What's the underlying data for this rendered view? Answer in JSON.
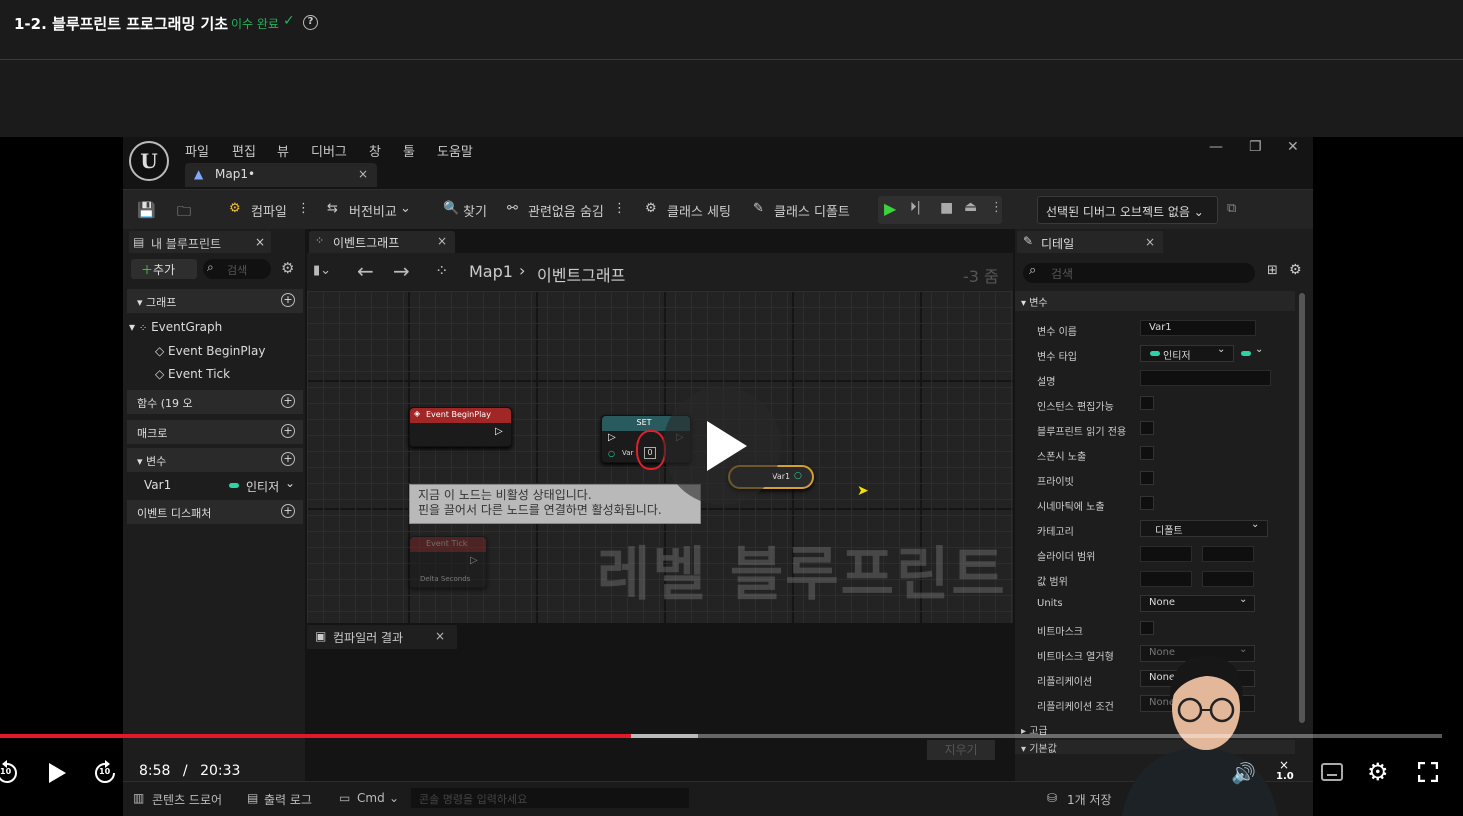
{
  "header": {
    "title": "1-2. 블루프린트 프로그래밍 기초",
    "status": "이수 완료",
    "help": "?"
  },
  "ue": {
    "menu": [
      "파일",
      "편집",
      "뷰",
      "디버그",
      "창",
      "툴",
      "도움말"
    ],
    "logo": "U",
    "map_tab": "Map1•",
    "toolbar": {
      "compile": "컴파일",
      "diff": "버전비교",
      "find": "찾기",
      "hide_unrelated": "관련없음 숨김",
      "class_settings": "클래스 세팅",
      "class_defaults": "클래스 디폴트",
      "debug_object": "선택된 디버그 오브젝트 없음"
    },
    "my_blueprint": {
      "tab": "내 블루프린트",
      "add": "추가",
      "search_placeholder": "검색",
      "graphs": "그래프",
      "event_graph": "EventGraph",
      "begin_play": "Event BeginPlay",
      "tick": "Event Tick",
      "functions": "함수 (19 오",
      "macros": "매크로",
      "variables": "변수",
      "var_name": "Var1",
      "var_type": "인티저",
      "dispatchers": "이벤트 디스패처"
    },
    "graph": {
      "tab": "이벤트그래프",
      "breadcrumb_root": "Map1",
      "breadcrumb_current": "이벤트그래프",
      "zoom": "-3 줌",
      "node_begin": "Event BeginPlay",
      "node_set": "SET",
      "node_set_var": "Var",
      "node_set_value": "0",
      "node_get": "Var1",
      "node_tick": "Event Tick",
      "node_tick_pin": "Delta Seconds",
      "tooltip_line1": "지금 이 노드는 비활성 상태입니다.",
      "tooltip_line2": "핀을 끌어서 다른 노드를 연결하면 활성화됩니다.",
      "watermark": "레벨 블루프린트"
    },
    "compiler": {
      "tab": "컴파일러 결과",
      "clear": "지우기"
    },
    "details": {
      "tab": "디테일",
      "search_placeholder": "검색",
      "section_variable": "변수",
      "labels": [
        "변수 이름",
        "변수 타입",
        "설명",
        "인스턴스 편집가능",
        "블루프린트 읽기 전용",
        "스폰시 노출",
        "프라이빗",
        "시네마틱에 노출",
        "카테고리",
        "슬라이더 범위",
        "값 범위",
        "Units",
        "비트마스크",
        "비트마스크 열거형",
        "리플리케이션",
        "리플리케이션 조건"
      ],
      "var_name_value": "Var1",
      "var_type_value": "인티저",
      "category_value": "디폴트",
      "units_value": "None",
      "enum_value": "None",
      "replication_value": "None",
      "rep_condition_value": "None",
      "section_advanced": "고급",
      "section_default": "기본값"
    },
    "bottom": {
      "content_drawer": "콘텐츠 드로어",
      "output_log": "출력 로그",
      "cmd": "Cmd",
      "console_placeholder": "콘솔 명령을 입력하세요",
      "save_status": "1개 저장"
    }
  },
  "player": {
    "current_time": "8:58",
    "separator": "/",
    "duration": "20:33",
    "progress_fraction": 0.4376,
    "buffered_fraction": 0.4843,
    "skip_back": "10",
    "skip_forward": "10",
    "speed": "1.0"
  },
  "colors": {
    "accent_red": "#e2192c",
    "complete_green": "#21b35a",
    "integer_pin": "#2ed3a5",
    "event_node": "#a12626",
    "set_node": "#295a5e"
  }
}
